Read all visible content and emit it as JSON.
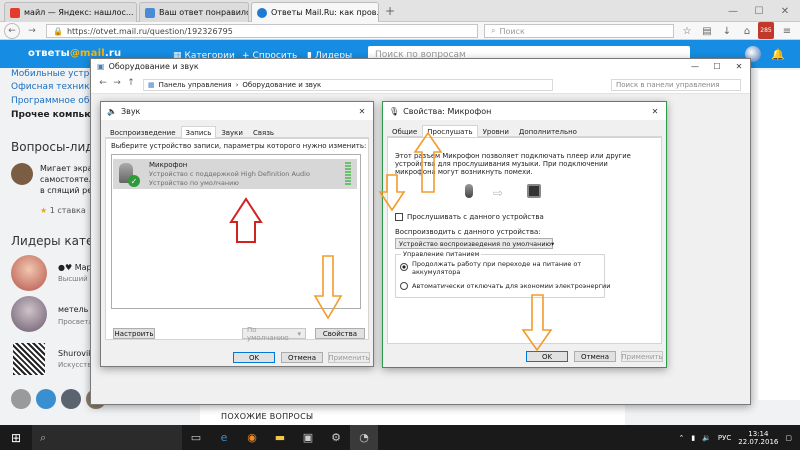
{
  "browser": {
    "tabs": [
      {
        "label": "майл — Яндекс: нашлос...",
        "close": "×",
        "color": "#e53b2c"
      },
      {
        "label": "Ваш ответ понравился - ...",
        "close": "×",
        "color": "#4a8bd6"
      },
      {
        "label": "Ответы Mail.Ru: как пров...",
        "close": "×",
        "color": "#1f7bd2"
      }
    ],
    "new_tab": "+",
    "url": "https://otvet.mail.ru/question/192326795",
    "search_placeholder": "Поиск",
    "badge": "285"
  },
  "site": {
    "logo_text": "ответы",
    "logo_mail": "@mail",
    "logo_ru": ".ru",
    "nav": [
      {
        "label": "Категории",
        "icon": "grid-icon"
      },
      {
        "label": "Спросить",
        "icon": "plus-icon"
      },
      {
        "label": "Лидеры",
        "icon": "bars-icon"
      }
    ],
    "search_placeholder": "Поиск по вопросам",
    "sidebar_links": [
      "Мобильные устройс",
      "Офисная техника",
      "Программное обесп",
      "Прочее компьютер"
    ],
    "questions_heading": "Вопросы-лидер",
    "question_lines": [
      "Мигает экран",
      "самостоятел",
      "в спящий реж"
    ],
    "question_rating": "1 ставка",
    "leaders_heading": "Лидеры катего",
    "leaders": [
      {
        "name": "●♥ Мари",
        "status": "Высший"
      },
      {
        "name": "метель в",
        "status": "Просветл"
      },
      {
        "name": "Shurovik",
        "status": "Искусстве"
      }
    ],
    "similar_heading": "ПОХОЖИЕ ВОПРОСЫ"
  },
  "control_panel": {
    "title": "Оборудование и звук",
    "breadcrumb": [
      "Панель управления",
      "Оборудование и звук"
    ],
    "search_placeholder": "Поиск в панели управления"
  },
  "sound_dialog": {
    "title": "Звук",
    "tabs": [
      "Воспроизведение",
      "Запись",
      "Звуки",
      "Связь"
    ],
    "active_tab": 1,
    "instruction": "Выберите устройство записи, параметры которого нужно изменить:",
    "device": {
      "name": "Микрофон",
      "desc": "Устройство с поддержкой High Definition Audio",
      "status": "Устройство по умолчанию"
    },
    "configure": "Настроить",
    "default_label": "По умолчанию",
    "properties": "Свойства",
    "ok": "OK",
    "cancel": "Отмена",
    "apply": "Применить"
  },
  "mic_dialog": {
    "title": "Свойства: Микрофон",
    "tabs": [
      "Общие",
      "Прослушать",
      "Уровни",
      "Дополнительно"
    ],
    "active_tab": 1,
    "description": [
      "Этот разъем Микрофон позволяет подключать плеер или другие",
      "устройства для прослушивания музыки. При подключении",
      "микрофона могут возникнуть помехи."
    ],
    "listen_checkbox": "Прослушивать с данного устройства",
    "listen_checked": false,
    "playback_label": "Воспроизводить с данного устройства:",
    "playback_value": "Устройство воспроизведения по умолчанию",
    "power_group": "Управление питанием",
    "power_options": [
      "Продолжать работу при переходе на питание от аккумулятора",
      "Автоматически отключать для экономии электроэнергии"
    ],
    "power_selected": 0,
    "ok": "OK",
    "cancel": "Отмена",
    "apply": "Применить"
  },
  "taskbar": {
    "time": "13:14",
    "date": "22.07.2016",
    "lang": "РУС"
  },
  "colors": {
    "mail_blue": "#168de2",
    "annotation_orange": "#f39b2b",
    "annotation_red": "#d22323",
    "taskbar": "#1a1a1a"
  }
}
